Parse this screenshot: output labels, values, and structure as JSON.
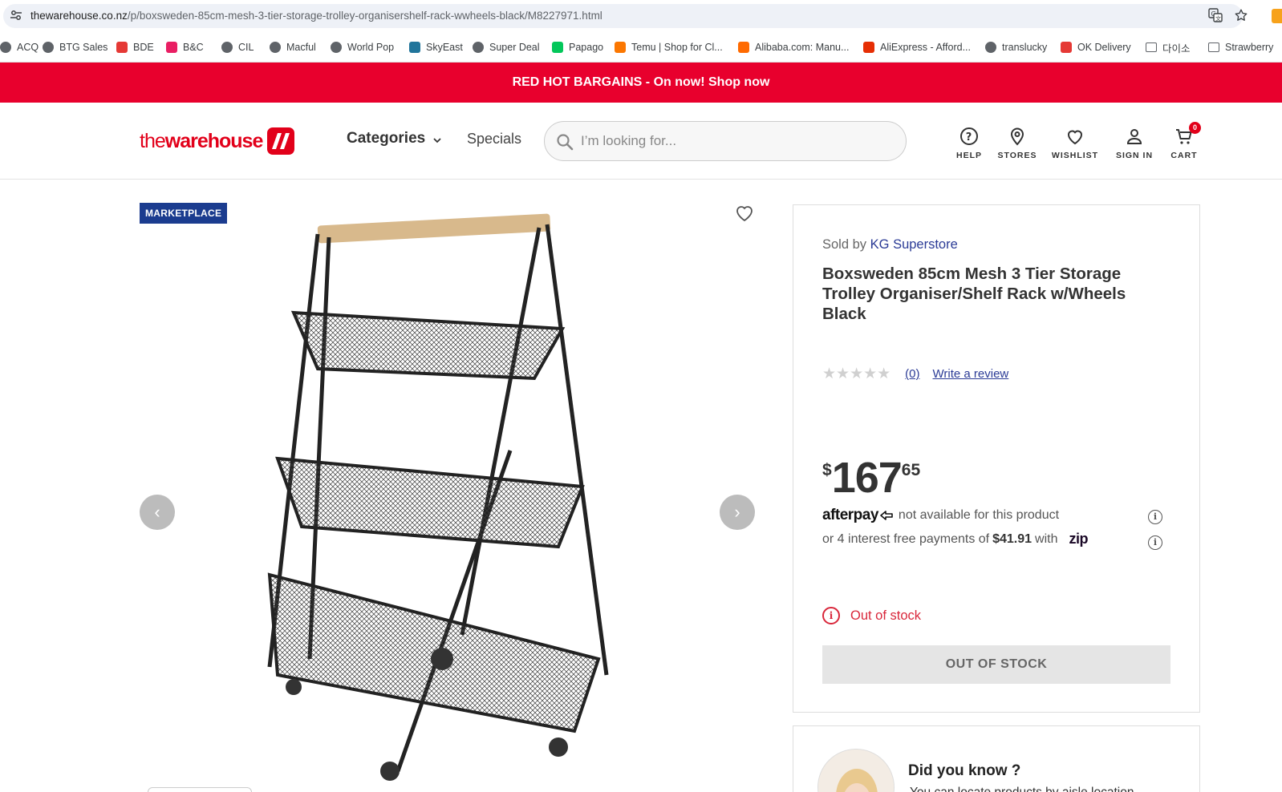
{
  "browser": {
    "url_domain": "thewarehouse.co.nz",
    "url_path": "/p/boxsweden-85cm-mesh-3-tier-storage-trolley-organisershelf-rack-wwheels-black/M8227971.html",
    "bookmarks": [
      {
        "label": "ACQ",
        "icon": "globe-icon",
        "color": "#5f6368"
      },
      {
        "label": "BTG Sales",
        "icon": "globe-icon",
        "color": "#5f6368"
      },
      {
        "label": "BDE",
        "icon": "arrow-up-icon",
        "color": "#e53935"
      },
      {
        "label": "B&C",
        "icon": "shoe-icon",
        "color": "#e91e63"
      },
      {
        "label": "CIL",
        "icon": "globe-icon",
        "color": "#5f6368"
      },
      {
        "label": "Macful",
        "icon": "globe-icon",
        "color": "#5f6368"
      },
      {
        "label": "World Pop",
        "icon": "globe-icon",
        "color": "#5f6368"
      },
      {
        "label": "SkyEast",
        "icon": "wordpress-icon",
        "color": "#21759b"
      },
      {
        "label": "Super Deal",
        "icon": "globe-icon",
        "color": "#5f6368"
      },
      {
        "label": "Papago",
        "icon": "papago-icon",
        "color": "#03c75a"
      },
      {
        "label": "Temu | Shop for Cl...",
        "icon": "temu-icon",
        "color": "#fb7701"
      },
      {
        "label": "Alibaba.com: Manu...",
        "icon": "alibaba-icon",
        "color": "#ff6a00"
      },
      {
        "label": "AliExpress - Afford...",
        "icon": "aliexpress-icon",
        "color": "#e62e04"
      },
      {
        "label": "translucky",
        "icon": "globe-icon",
        "color": "#5f6368"
      },
      {
        "label": "OK Delivery",
        "icon": "ok-icon",
        "color": "#e53935"
      },
      {
        "label": "다이소",
        "icon": "folder-icon",
        "color": "#5f6368"
      },
      {
        "label": "Strawberry",
        "icon": "folder-icon",
        "color": "#5f6368"
      }
    ]
  },
  "promo": {
    "text": "RED HOT BARGAINS - On now! Shop now",
    "color": "#e8002d"
  },
  "header": {
    "logo_the": "the",
    "logo_warehouse": "warehouse",
    "categories": "Categories",
    "specials": "Specials",
    "search_placeholder": "I’m looking for...",
    "icons": {
      "help": "HELP",
      "stores": "STORES",
      "wishlist": "WISHLIST",
      "signin": "SIGN IN",
      "cart": "CART"
    },
    "cart_count": "0"
  },
  "product": {
    "badge": "MARKETPLACE",
    "sold_by_prefix": "Sold by",
    "seller": "KG Superstore",
    "title": "Boxsweden 85cm Mesh 3 Tier Storage Trolley Organiser/Shelf Rack w/Wheels Black",
    "rating_count": "(0)",
    "write_review": "Write a review",
    "stars": "★★★★★",
    "price_currency": "$",
    "price_dollars": "167",
    "price_cents": "65",
    "afterpay_logo": "afterpay",
    "afterpay_text": "not available for this product",
    "zip_prefix": "or 4 interest free payments of",
    "zip_amount": "$41.91",
    "zip_suffix": "with",
    "zip_logo": "zip",
    "stock_status": "Out of stock",
    "button": "OUT OF STOCK"
  },
  "did_you_know": {
    "title": "Did you know ?",
    "text": "You can locate products by aisle location"
  }
}
